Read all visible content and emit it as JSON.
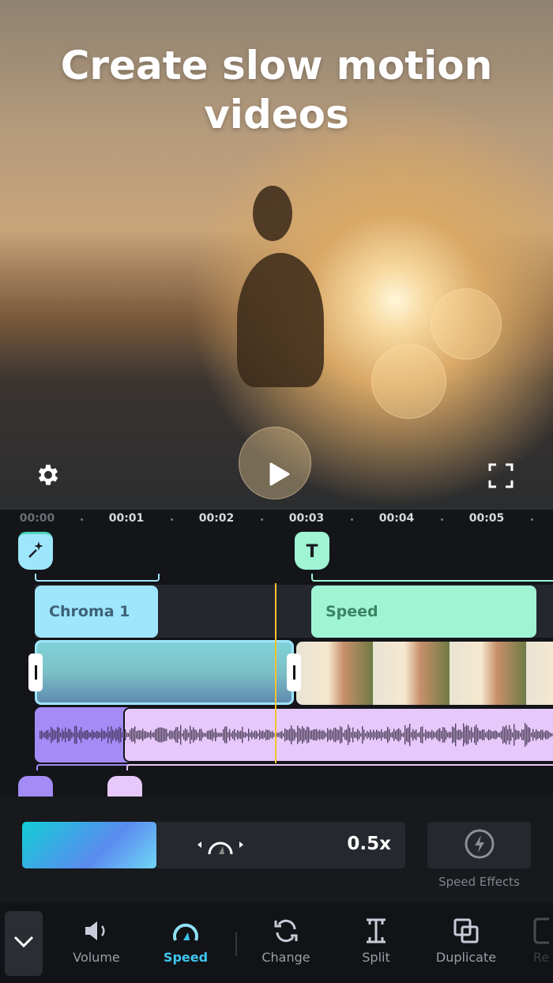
{
  "headline": "Create slow motion videos",
  "preview": {
    "settings_icon": "gear-icon",
    "play_icon": "play-icon",
    "fullscreen_icon": "fullscreen-icon"
  },
  "timeline": {
    "ruler": [
      "00:00",
      "00:01",
      "00:02",
      "00:03",
      "00:04",
      "00:05"
    ],
    "markers": {
      "effect_icon": "magic-wand-icon",
      "text_icon": "text-T-icon",
      "text_letter": "T"
    },
    "clips": [
      {
        "label": "Chroma 1",
        "color": "#9ee6fb"
      },
      {
        "label": "Speed",
        "color": "#9ff5d3"
      }
    ],
    "playhead_color": "#f2c230"
  },
  "speed_panel": {
    "value": "0.5x",
    "fraction": 0.35,
    "effects_label": "Speed Effects"
  },
  "toolbar": {
    "items": [
      {
        "label": "Volume",
        "icon": "volume-icon"
      },
      {
        "label": "Speed",
        "icon": "speedometer-icon",
        "active": true
      },
      {
        "label": "Change",
        "icon": "replace-icon"
      },
      {
        "label": "Split",
        "icon": "split-icon"
      },
      {
        "label": "Duplicate",
        "icon": "duplicate-icon"
      },
      {
        "label": "Re",
        "icon": "reverse-icon"
      }
    ]
  },
  "colors": {
    "accent": "#3ec6f0",
    "audio_dark": "#a38cf6",
    "audio_light": "#e6c8fb"
  }
}
